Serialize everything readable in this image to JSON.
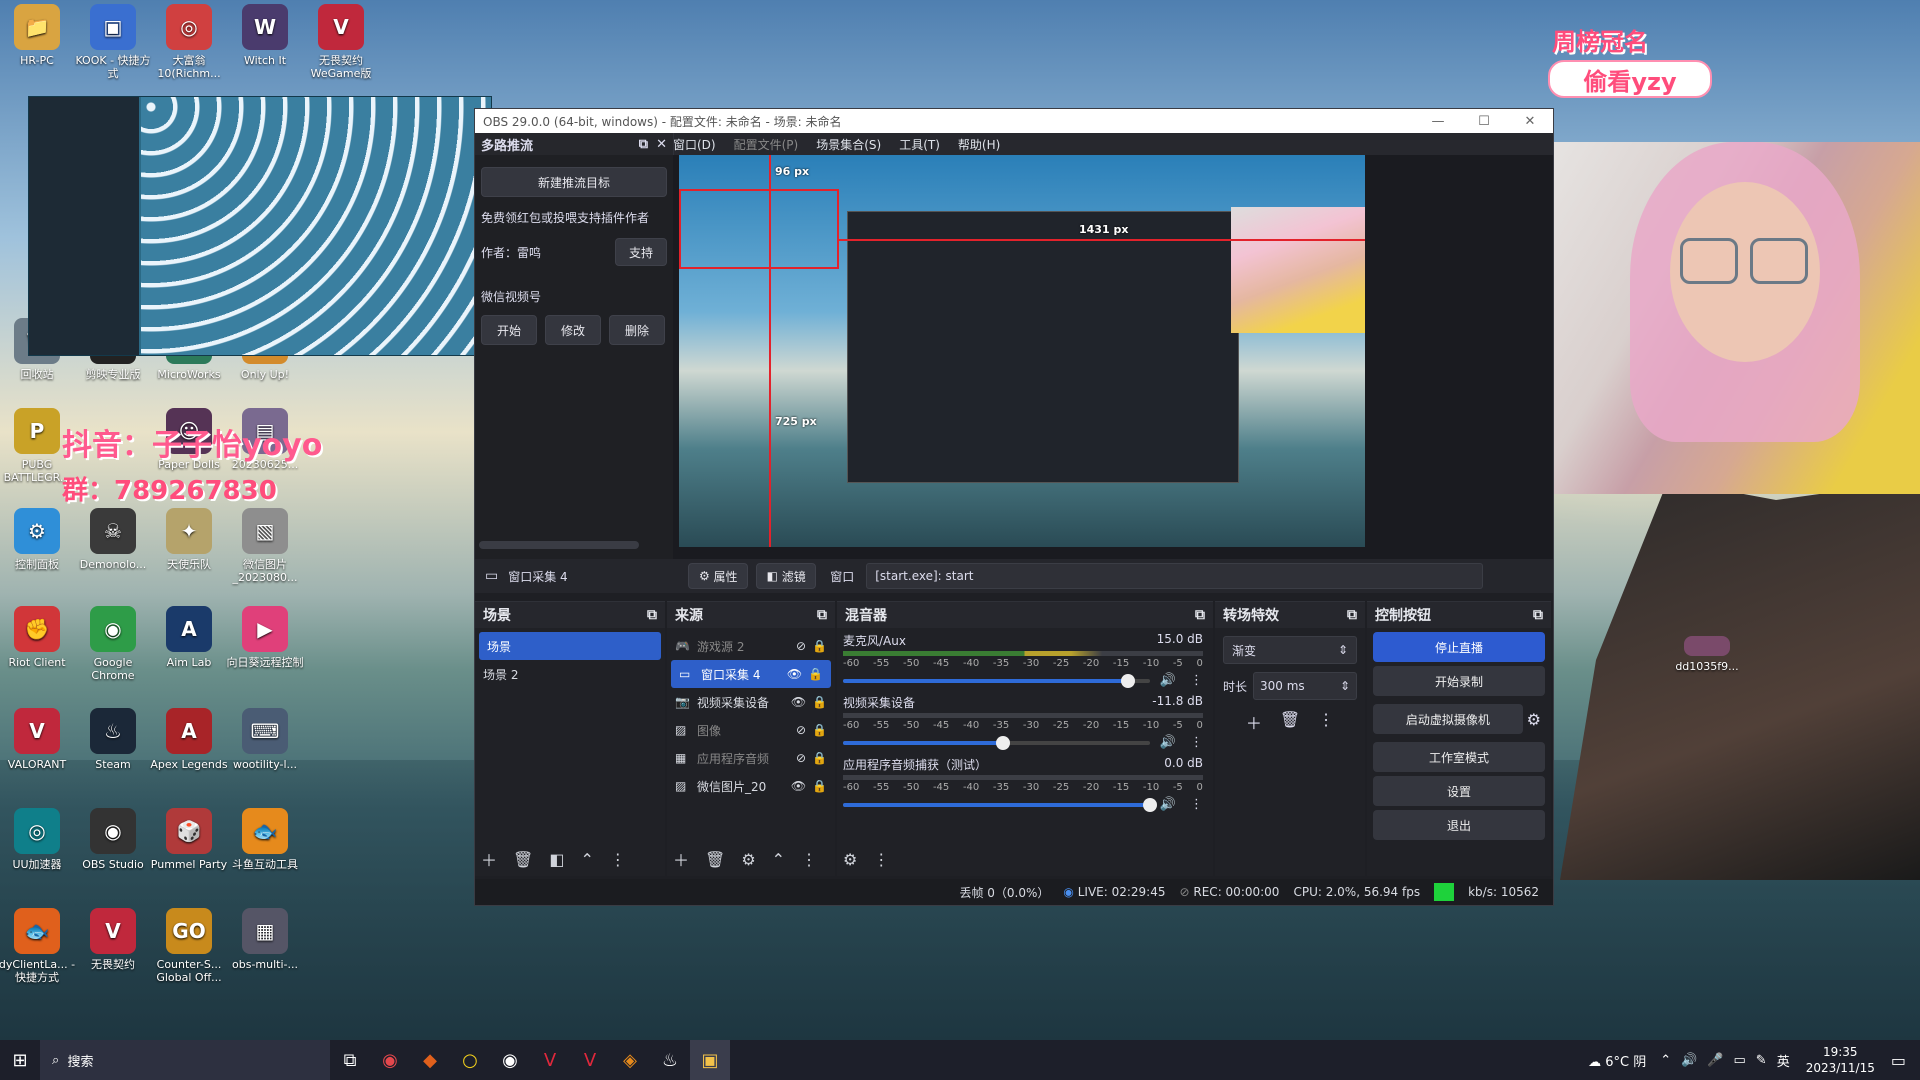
{
  "desktop": {
    "icons": [
      {
        "label": "HR-PC",
        "glyph": "📁",
        "color": "#d9a441"
      },
      {
        "label": "KOOK - 快捷方式",
        "glyph": "▣",
        "color": "#3a6fd0"
      },
      {
        "label": "大富翁10(Richm...",
        "glyph": "◎",
        "color": "#d04040"
      },
      {
        "label": "Witch It",
        "glyph": "W",
        "color": "#4a3b6d"
      },
      {
        "label": "无畏契约 WeGame版",
        "glyph": "V",
        "color": "#c0283c"
      },
      {
        "label": "回收站",
        "glyph": "🗑",
        "color": "#6c7c88"
      },
      {
        "label": "剪映专业版",
        "glyph": "✂",
        "color": "#222"
      },
      {
        "label": "MicroWorks",
        "glyph": "M",
        "color": "#2c7a5a"
      },
      {
        "label": "Only Up!",
        "glyph": "↑",
        "color": "#d38b2c"
      },
      {
        "label": "PUBG BATTLEGR...",
        "glyph": "P",
        "color": "#c9a227"
      },
      {
        "label": "Paper Dolls",
        "glyph": "☺",
        "color": "#553355"
      },
      {
        "label": "20230625...",
        "glyph": "▤",
        "color": "#7a6a90"
      },
      {
        "label": "控制面板",
        "glyph": "⚙",
        "color": "#2f8fd8"
      },
      {
        "label": "Demonolo...",
        "glyph": "☠",
        "color": "#3a3a3a"
      },
      {
        "label": "天使乐队",
        "glyph": "✦",
        "color": "#b5a36b"
      },
      {
        "label": "微信图片_2023080...",
        "glyph": "▧",
        "color": "#8e8e8e"
      },
      {
        "label": "Riot Client",
        "glyph": "✊",
        "color": "#d13639"
      },
      {
        "label": "Google Chrome",
        "glyph": "◉",
        "color": "#2e9c48"
      },
      {
        "label": "Aim Lab",
        "glyph": "A",
        "color": "#1a3a6a"
      },
      {
        "label": "向日葵远程控制",
        "glyph": "▶",
        "color": "#e0407a"
      },
      {
        "label": "VALORANT",
        "glyph": "V",
        "color": "#c0283c"
      },
      {
        "label": "Steam",
        "glyph": "♨",
        "color": "#1b2838"
      },
      {
        "label": "Apex Legends",
        "glyph": "A",
        "color": "#a82428"
      },
      {
        "label": "wootility-l...",
        "glyph": "⌨",
        "color": "#4a5c74"
      },
      {
        "label": "UU加速器",
        "glyph": "◎",
        "color": "#0f7f8a"
      },
      {
        "label": "OBS Studio",
        "glyph": "◉",
        "color": "#333"
      },
      {
        "label": "Pummel Party",
        "glyph": "🎲",
        "color": "#b03a3a"
      },
      {
        "label": "斗鱼互动工具",
        "glyph": "🐟",
        "color": "#e68a1c"
      },
      {
        "label": "dyClientLa... - 快捷方式",
        "glyph": "🐟",
        "color": "#e0601c"
      },
      {
        "label": "无畏契约",
        "glyph": "V",
        "color": "#c0283c"
      },
      {
        "label": "Counter-S... Global Off...",
        "glyph": "GO",
        "color": "#c88a1c"
      },
      {
        "label": "obs-multi-...",
        "glyph": "▦",
        "color": "#556"
      }
    ],
    "right_icon": {
      "label": "dd1035f9..."
    },
    "overlay": {
      "douyin": "抖音：子子怡yoyo",
      "qq_group": "群：789267830",
      "banner_title": "周榜冠名",
      "banner_name": "偷看yzy"
    }
  },
  "obs": {
    "title": "OBS 29.0.0 (64-bit, windows) - 配置文件: 未命名 - 场景: 未命名",
    "menu": [
      "窗口(D)",
      "配置文件(P)",
      "场景集合(S)",
      "工具(T)",
      "帮助(H)"
    ],
    "multistream": {
      "title": "多路推流",
      "new_target": "新建推流目标",
      "promo": "免费领红包或投喂支持插件作者",
      "author": "作者：雷鸣",
      "support": "支持",
      "channel": "微信视频号",
      "start": "开始",
      "edit": "修改",
      "delete": "删除"
    },
    "preview": {
      "lbl_top": "96 px",
      "lbl_mid": "1431 px",
      "lbl_left": "725 px"
    },
    "source_bar": {
      "source_name": "窗口采集 4",
      "properties": "属性",
      "filters": "滤镜",
      "window_label": "窗口",
      "window_value": "[start.exe]: start"
    },
    "scenes": {
      "title": "场景",
      "items": [
        "场景",
        "场景 2"
      ]
    },
    "sources": {
      "title": "来源",
      "items": [
        "游戏源 2",
        "窗口采集 4",
        "视频采集设备",
        "图像",
        "应用程序音频",
        "微信图片_20"
      ]
    },
    "mixer": {
      "title": "混音器",
      "ticks": [
        "-60",
        "-55",
        "-50",
        "-45",
        "-40",
        "-35",
        "-30",
        "-25",
        "-20",
        "-15",
        "-10",
        "-5",
        "0"
      ],
      "channels": [
        {
          "name": "麦克风/Aux",
          "db": "15.0 dB",
          "level": 0.72,
          "volume": 0.93
        },
        {
          "name": "视频采集设备",
          "db": "-11.8 dB",
          "level": 0.0,
          "volume": 0.52
        },
        {
          "name": "应用程序音频捕获（测试）",
          "db": "0.0 dB",
          "level": 0.0,
          "volume": 1.0
        }
      ]
    },
    "transitions": {
      "title": "转场特效",
      "type": "渐变",
      "duration_label": "时长",
      "duration": "300 ms"
    },
    "controls": {
      "title": "控制按钮",
      "items": [
        "停止直播",
        "开始录制",
        "启动虚拟摄像机",
        "工作室模式",
        "设置",
        "退出"
      ]
    },
    "status": {
      "dropped": "丢帧 0（0.0%）",
      "live": "LIVE: 02:29:45",
      "rec": "REC: 00:00:00",
      "cpu": "CPU: 2.0%, 56.94 fps",
      "kbs": "kb/s: 10562"
    }
  },
  "taskbar": {
    "search": "搜索",
    "weather": "6°C 阴",
    "ime": "英",
    "time": "19:35",
    "date": "2023/11/15"
  }
}
